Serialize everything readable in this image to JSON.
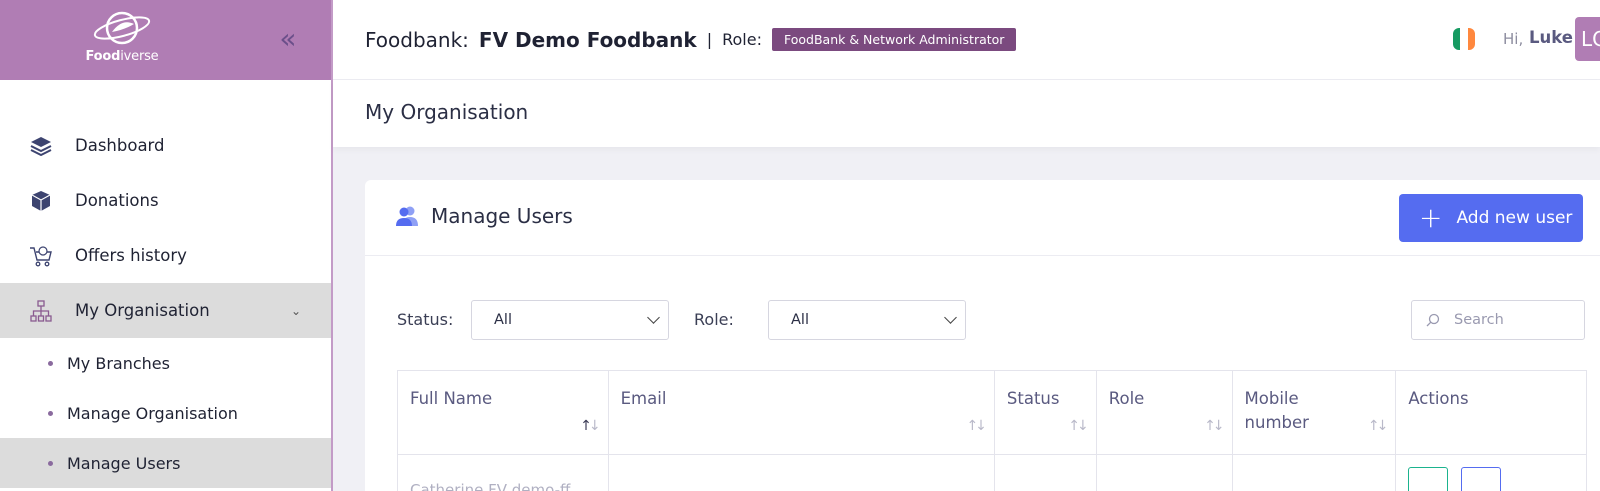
{
  "brand": {
    "logo_text_bold": "Food",
    "logo_text_light": "iverse",
    "collapse_icon": "double-chevron-left-icon"
  },
  "sidebar": {
    "items": [
      {
        "label": "Dashboard",
        "icon": "layers-icon"
      },
      {
        "label": "Donations",
        "icon": "box-icon"
      },
      {
        "label": "Offers history",
        "icon": "cart-icon"
      },
      {
        "label": "My Organisation",
        "icon": "org-chart-icon"
      }
    ],
    "subitems": [
      {
        "label": "My Branches"
      },
      {
        "label": "Manage Organisation"
      },
      {
        "label": "Manage Users"
      }
    ]
  },
  "header": {
    "foodbank_label": "Foodbank:",
    "foodbank_name": "FV Demo Foodbank",
    "separator": "|",
    "role_label": "Role:",
    "role_badge": "FoodBank & Network Administrator",
    "greeting": "Hi,",
    "user_name": "Luke",
    "avatar_initials": "LC",
    "flag": {
      "colors": [
        "#169b62",
        "#ffffff",
        "#ff883e"
      ]
    }
  },
  "page": {
    "title": "My Organisation"
  },
  "card": {
    "title": "Manage Users",
    "add_button_label": "Add new user",
    "filters": {
      "status_label": "Status:",
      "status_value": "All",
      "role_label": "Role:",
      "role_value": "All",
      "search_placeholder": "Search"
    },
    "table": {
      "columns": [
        "Full Name",
        "Email",
        "Status",
        "Role",
        "Mobile number",
        "Actions"
      ],
      "first_row_name": "Catherine FV demo-ff"
    }
  },
  "colors": {
    "brand_purple": "#b07db4",
    "badge_purple": "#7b4a7f",
    "primary_blue": "#556cf0",
    "view_green": "#1bb38e"
  }
}
